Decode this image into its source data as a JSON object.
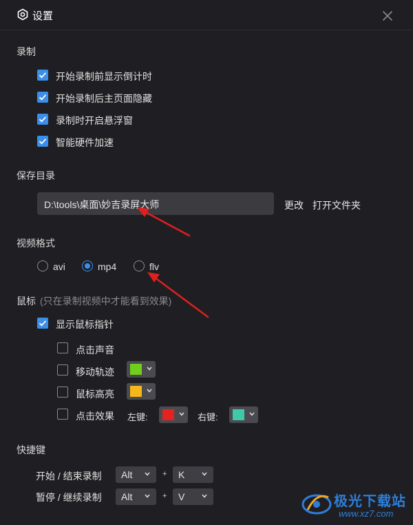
{
  "window": {
    "title": "设置"
  },
  "record": {
    "title": "录制",
    "options": [
      {
        "label": "开始录制前显示倒计时",
        "checked": true
      },
      {
        "label": "开始录制后主页面隐藏",
        "checked": true
      },
      {
        "label": "录制时开启悬浮窗",
        "checked": true
      },
      {
        "label": "智能硬件加速",
        "checked": true
      }
    ]
  },
  "save_dir": {
    "title": "保存目录",
    "path": "D:\\tools\\桌面\\妙吉录屏大师",
    "change_label": "更改",
    "open_label": "打开文件夹"
  },
  "video_format": {
    "title": "视频格式",
    "options": [
      {
        "label": "avi",
        "selected": false
      },
      {
        "label": "mp4",
        "selected": true
      },
      {
        "label": "flv",
        "selected": false
      }
    ]
  },
  "mouse": {
    "title": "鼠标",
    "hint": "(只在录制视频中才能看到效果)",
    "show_pointer_label": "显示鼠标指针",
    "show_pointer_checked": true,
    "click_sound_label": "点击声音",
    "move_track_label": "移动轨迹",
    "move_track_color": "#6fcf1a",
    "highlight_label": "鼠标高亮",
    "highlight_color": "#f5b818",
    "click_effect_label": "点击效果",
    "left_key_label": "左键:",
    "left_key_color": "#e52222",
    "right_key_label": "右键:",
    "right_key_color": "#3ec9a8"
  },
  "hotkeys": {
    "title": "快捷键",
    "start_stop_label": "开始 / 结束录制",
    "start_stop_mod": "Alt",
    "start_stop_key": "K",
    "pause_resume_label": "暂停 / 继续录制",
    "pause_resume_mod": "Alt",
    "pause_resume_key": "V",
    "plus": "+"
  },
  "watermark": {
    "name": "极光下载站",
    "url": "www.xz7.com"
  },
  "colors": {
    "accent": "#3b8eea",
    "background": "#1f1f23",
    "annotation_arrow": "#e01f1f"
  },
  "icons": {
    "title": "gear-icon",
    "close": "close-icon",
    "check": "checkmark-icon",
    "dropdown": "chevron-down-icon"
  }
}
